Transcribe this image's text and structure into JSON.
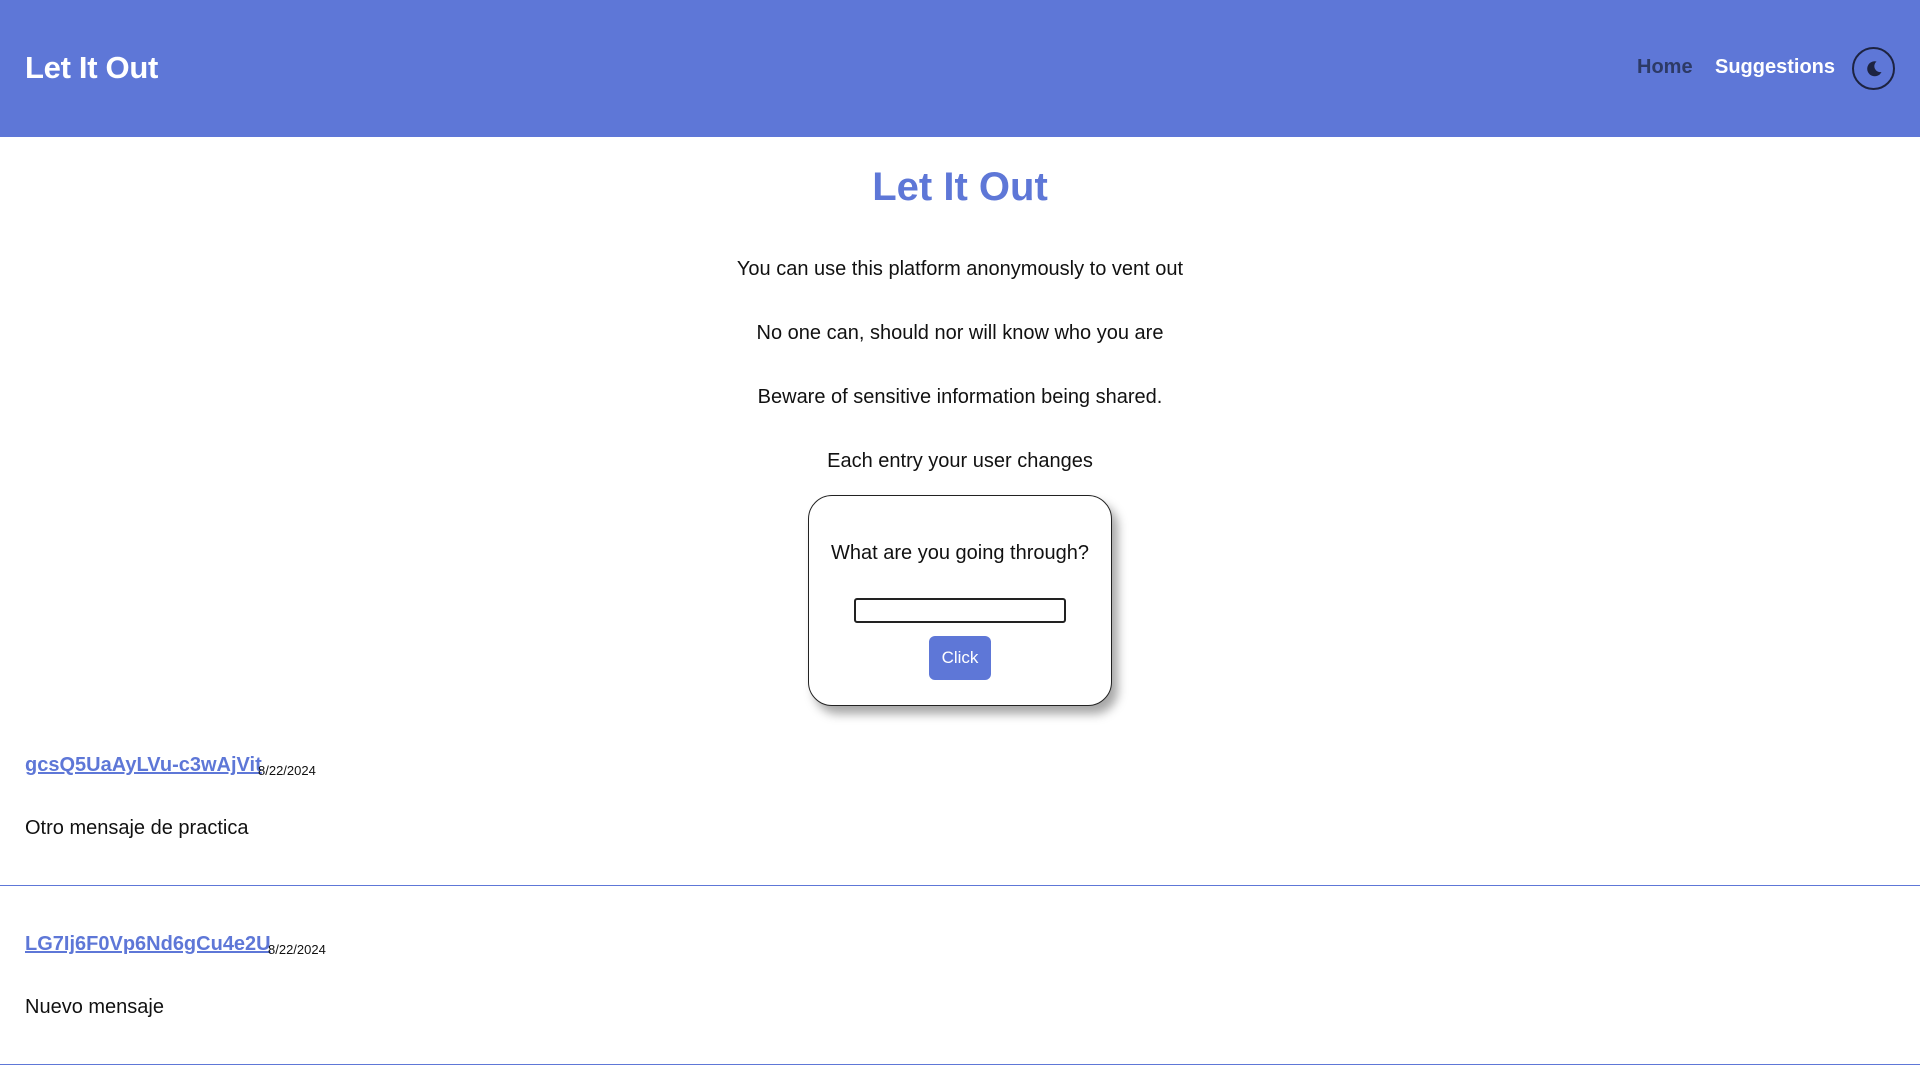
{
  "header": {
    "brand": "Let It Out",
    "nav": {
      "home": "Home",
      "suggestions": "Suggestions"
    },
    "theme_toggle_icon": "moon-icon"
  },
  "main": {
    "title": "Let It Out",
    "intro": [
      "You can use this platform anonymously to vent out",
      "No one can, should nor will know who you are",
      "Beware of sensitive information being shared.",
      "Each entry your user changes"
    ],
    "form": {
      "question": "What are you going through?",
      "input_value": "",
      "button_label": "Click"
    }
  },
  "posts": [
    {
      "user": "gcsQ5UaAyLVu-c3wAjVit",
      "date": "8/22/2024",
      "message": "Otro mensaje de practica"
    },
    {
      "user": "LG7Ij6F0Vp6Nd6gCu4e2U",
      "date": "8/22/2024",
      "message": "Nuevo mensaje"
    }
  ],
  "colors": {
    "accent": "#5e77d7",
    "nav_home": "#2d3a66",
    "text": "#111111",
    "background": "#ffffff"
  }
}
